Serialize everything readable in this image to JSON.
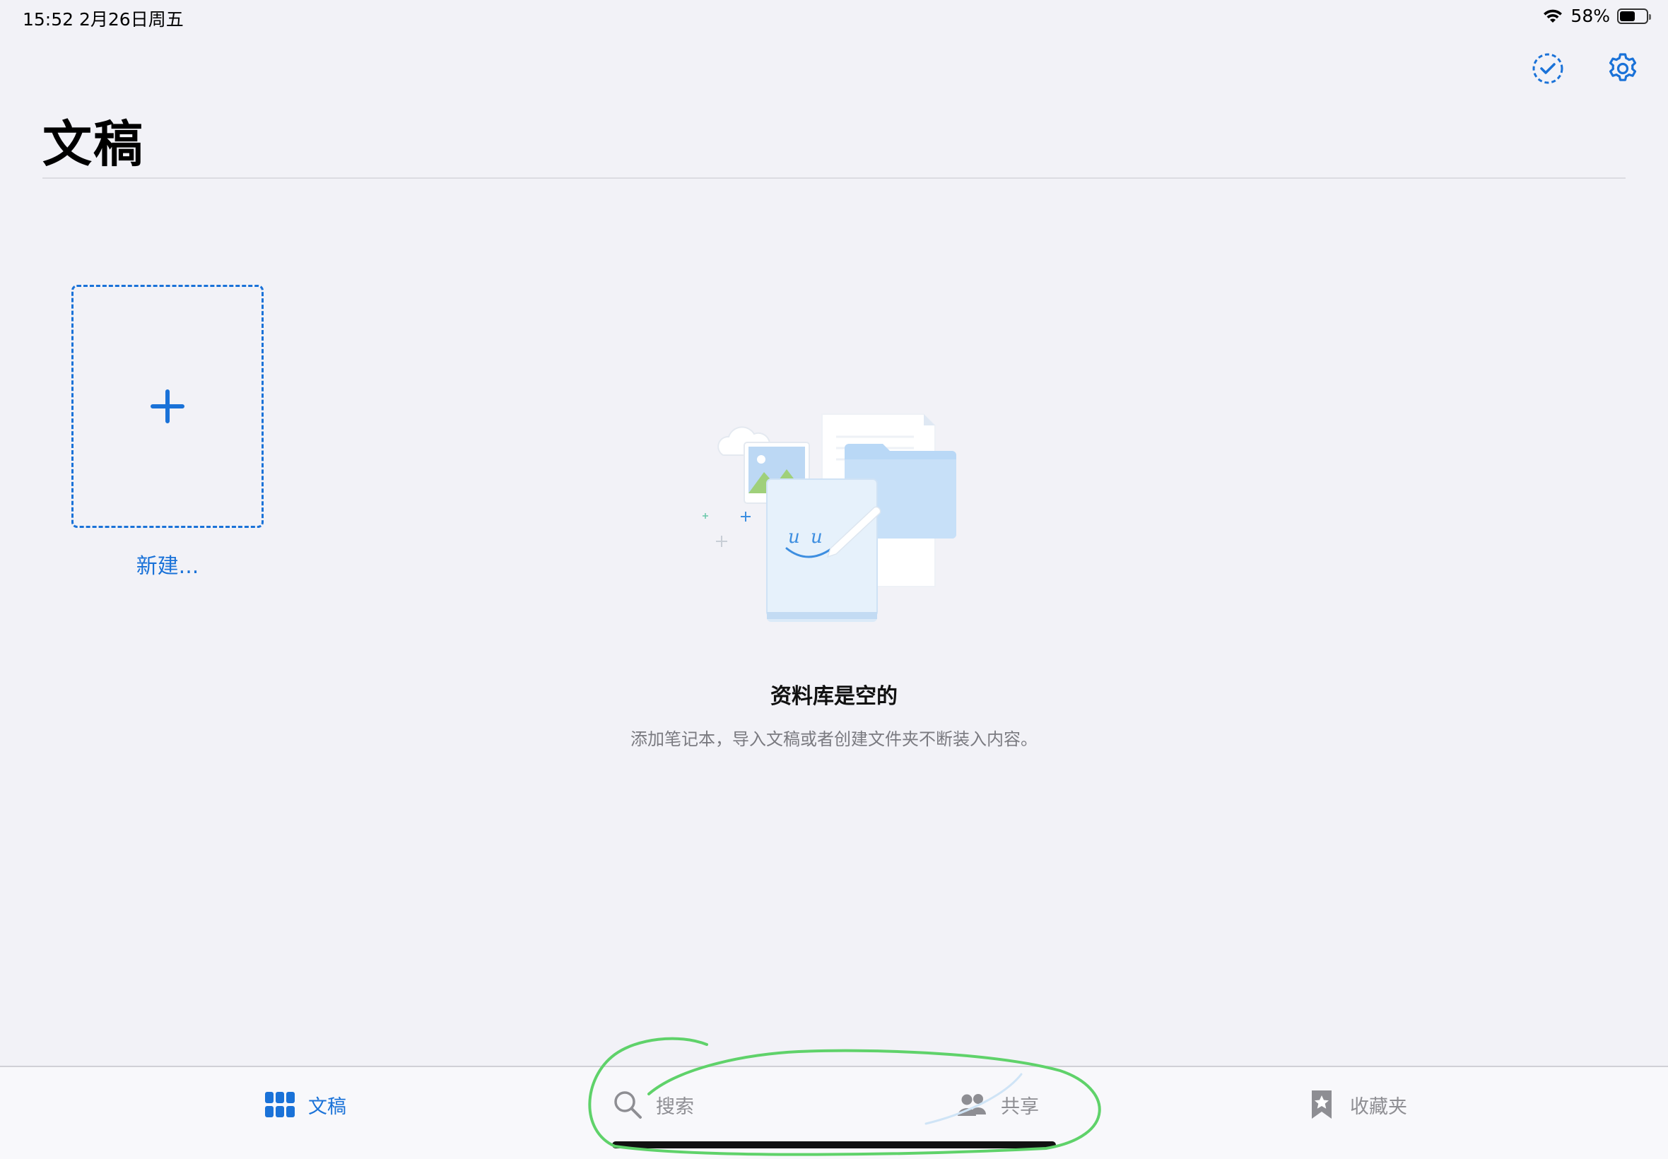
{
  "status_bar": {
    "time_date": "15:52   2月26日周五",
    "battery_percent": "58%",
    "battery_level": 0.58
  },
  "toolbar": {
    "select_icon": "checkmark-circle-dashed-icon",
    "settings_icon": "gear-icon"
  },
  "header": {
    "title": "文稿"
  },
  "new_document": {
    "label": "新建..."
  },
  "empty_state": {
    "title": "资料库是空的",
    "description": "添加笔记本，导入文稿或者创建文件夹不断装入内容。"
  },
  "tab_bar": {
    "items": [
      {
        "label": "文稿",
        "icon": "grid-icon",
        "selected": true
      },
      {
        "label": "搜索",
        "icon": "search-icon",
        "selected": false
      },
      {
        "label": "共享",
        "icon": "people-icon",
        "selected": false
      },
      {
        "label": "收藏夹",
        "icon": "bookmark-star-icon",
        "selected": false
      }
    ]
  },
  "colors": {
    "accent": "#1a72d8",
    "background": "#f2f2f7",
    "inactive": "#8e8e93",
    "annotation": "#5fd26a"
  }
}
